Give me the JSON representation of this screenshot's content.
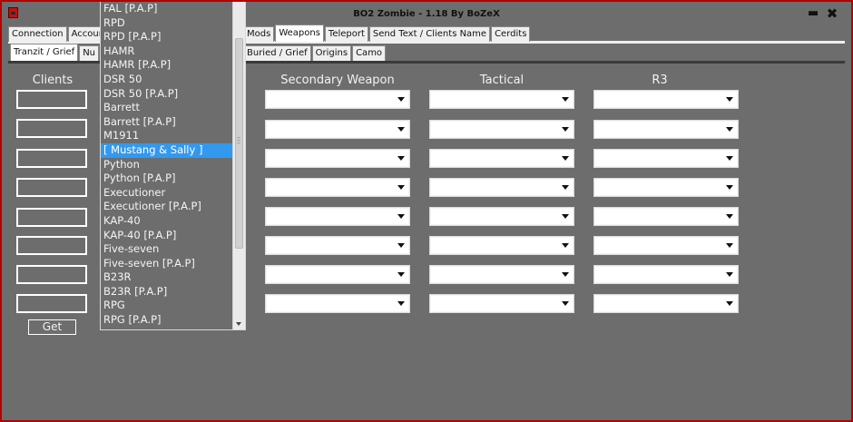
{
  "window": {
    "title": "BO2 Zombie - 1.18 By BoZeX",
    "minimize_label": "▬",
    "close_label": "✖",
    "border_color": "#b20000",
    "background_color": "#6d6d6d"
  },
  "main_tabs": [
    {
      "label": "Connection"
    },
    {
      "label": "Account"
    },
    {
      "label": "Mods"
    },
    {
      "label": "Weapons",
      "active": true
    },
    {
      "label": "Teleport"
    },
    {
      "label": "Send Text  / Clients Name"
    },
    {
      "label": "Cerdits"
    }
  ],
  "sub_tabs": [
    {
      "label": "Tranzit / Grief",
      "active": true
    },
    {
      "label": "Nu"
    },
    {
      "label": "Buried / Grief"
    },
    {
      "label": "Origins"
    },
    {
      "label": "Camo"
    }
  ],
  "columns": {
    "clients": "Clients",
    "secondary": "Secondary Weapon",
    "tactical": "Tactical",
    "r3": "R3"
  },
  "get_button": "Get",
  "dropdown": {
    "items": [
      "FAL [P.A.P]",
      "RPD",
      "RPD [P.A.P]",
      "HAMR",
      "HAMR [P.A.P]",
      "DSR 50",
      "DSR 50 [P.A.P]",
      "Barrett",
      "Barrett [P.A.P]",
      "M1911",
      "[ Mustang & Sally ]",
      "Python",
      "Python [P.A.P]",
      "Executioner",
      "Executioner [P.A.P]",
      "KAP-40",
      "KAP-40 [P.A.P]",
      "Five-seven",
      "Five-seven [P.A.P]",
      "B23R",
      "B23R [P.A.P]",
      "RPG",
      "RPG [P.A.P]"
    ],
    "selected": "[ Mustang & Sally ]",
    "selection_color": "#3399ee"
  }
}
